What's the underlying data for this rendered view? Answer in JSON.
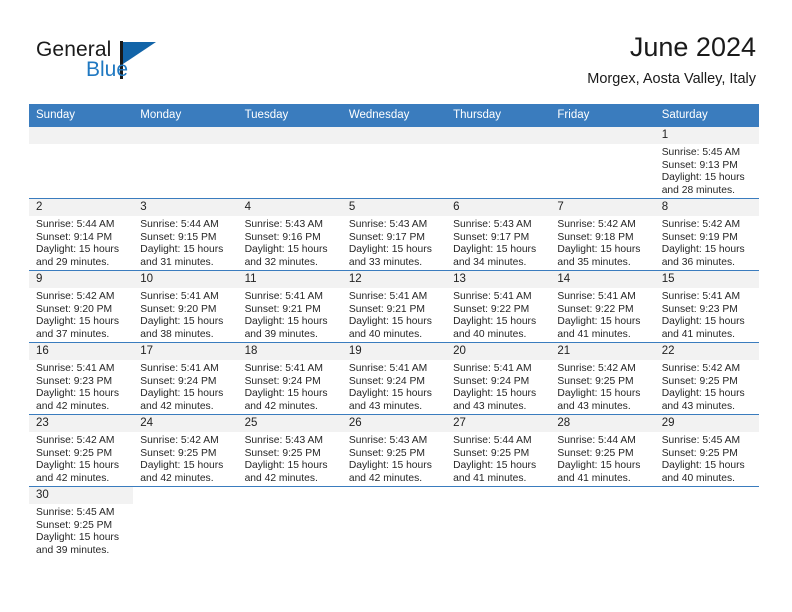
{
  "brand": {
    "word_one": "General",
    "word_two": "Blue",
    "flag_icon": "triangle-flag-icon"
  },
  "header": {
    "month_title": "June 2024",
    "location": "Morgex, Aosta Valley, Italy"
  },
  "colors": {
    "header_blue": "#3a7cbe",
    "brand_blue": "#1f78c1",
    "flag_blue": "#1264a8",
    "daynum_band": "#f2f2f2"
  },
  "weekdays": [
    "Sunday",
    "Monday",
    "Tuesday",
    "Wednesday",
    "Thursday",
    "Friday",
    "Saturday"
  ],
  "weeks": [
    [
      {
        "day": "",
        "empty": true
      },
      {
        "day": "",
        "empty": true
      },
      {
        "day": "",
        "empty": true
      },
      {
        "day": "",
        "empty": true
      },
      {
        "day": "",
        "empty": true
      },
      {
        "day": "",
        "empty": true
      },
      {
        "day": "1",
        "sunrise": "Sunrise: 5:45 AM",
        "sunset": "Sunset: 9:13 PM",
        "daylight_1": "Daylight: 15 hours",
        "daylight_2": "and 28 minutes."
      }
    ],
    [
      {
        "day": "2",
        "sunrise": "Sunrise: 5:44 AM",
        "sunset": "Sunset: 9:14 PM",
        "daylight_1": "Daylight: 15 hours",
        "daylight_2": "and 29 minutes."
      },
      {
        "day": "3",
        "sunrise": "Sunrise: 5:44 AM",
        "sunset": "Sunset: 9:15 PM",
        "daylight_1": "Daylight: 15 hours",
        "daylight_2": "and 31 minutes."
      },
      {
        "day": "4",
        "sunrise": "Sunrise: 5:43 AM",
        "sunset": "Sunset: 9:16 PM",
        "daylight_1": "Daylight: 15 hours",
        "daylight_2": "and 32 minutes."
      },
      {
        "day": "5",
        "sunrise": "Sunrise: 5:43 AM",
        "sunset": "Sunset: 9:17 PM",
        "daylight_1": "Daylight: 15 hours",
        "daylight_2": "and 33 minutes."
      },
      {
        "day": "6",
        "sunrise": "Sunrise: 5:43 AM",
        "sunset": "Sunset: 9:17 PM",
        "daylight_1": "Daylight: 15 hours",
        "daylight_2": "and 34 minutes."
      },
      {
        "day": "7",
        "sunrise": "Sunrise: 5:42 AM",
        "sunset": "Sunset: 9:18 PM",
        "daylight_1": "Daylight: 15 hours",
        "daylight_2": "and 35 minutes."
      },
      {
        "day": "8",
        "sunrise": "Sunrise: 5:42 AM",
        "sunset": "Sunset: 9:19 PM",
        "daylight_1": "Daylight: 15 hours",
        "daylight_2": "and 36 minutes."
      }
    ],
    [
      {
        "day": "9",
        "sunrise": "Sunrise: 5:42 AM",
        "sunset": "Sunset: 9:20 PM",
        "daylight_1": "Daylight: 15 hours",
        "daylight_2": "and 37 minutes."
      },
      {
        "day": "10",
        "sunrise": "Sunrise: 5:41 AM",
        "sunset": "Sunset: 9:20 PM",
        "daylight_1": "Daylight: 15 hours",
        "daylight_2": "and 38 minutes."
      },
      {
        "day": "11",
        "sunrise": "Sunrise: 5:41 AM",
        "sunset": "Sunset: 9:21 PM",
        "daylight_1": "Daylight: 15 hours",
        "daylight_2": "and 39 minutes."
      },
      {
        "day": "12",
        "sunrise": "Sunrise: 5:41 AM",
        "sunset": "Sunset: 9:21 PM",
        "daylight_1": "Daylight: 15 hours",
        "daylight_2": "and 40 minutes."
      },
      {
        "day": "13",
        "sunrise": "Sunrise: 5:41 AM",
        "sunset": "Sunset: 9:22 PM",
        "daylight_1": "Daylight: 15 hours",
        "daylight_2": "and 40 minutes."
      },
      {
        "day": "14",
        "sunrise": "Sunrise: 5:41 AM",
        "sunset": "Sunset: 9:22 PM",
        "daylight_1": "Daylight: 15 hours",
        "daylight_2": "and 41 minutes."
      },
      {
        "day": "15",
        "sunrise": "Sunrise: 5:41 AM",
        "sunset": "Sunset: 9:23 PM",
        "daylight_1": "Daylight: 15 hours",
        "daylight_2": "and 41 minutes."
      }
    ],
    [
      {
        "day": "16",
        "sunrise": "Sunrise: 5:41 AM",
        "sunset": "Sunset: 9:23 PM",
        "daylight_1": "Daylight: 15 hours",
        "daylight_2": "and 42 minutes."
      },
      {
        "day": "17",
        "sunrise": "Sunrise: 5:41 AM",
        "sunset": "Sunset: 9:24 PM",
        "daylight_1": "Daylight: 15 hours",
        "daylight_2": "and 42 minutes."
      },
      {
        "day": "18",
        "sunrise": "Sunrise: 5:41 AM",
        "sunset": "Sunset: 9:24 PM",
        "daylight_1": "Daylight: 15 hours",
        "daylight_2": "and 42 minutes."
      },
      {
        "day": "19",
        "sunrise": "Sunrise: 5:41 AM",
        "sunset": "Sunset: 9:24 PM",
        "daylight_1": "Daylight: 15 hours",
        "daylight_2": "and 43 minutes."
      },
      {
        "day": "20",
        "sunrise": "Sunrise: 5:41 AM",
        "sunset": "Sunset: 9:24 PM",
        "daylight_1": "Daylight: 15 hours",
        "daylight_2": "and 43 minutes."
      },
      {
        "day": "21",
        "sunrise": "Sunrise: 5:42 AM",
        "sunset": "Sunset: 9:25 PM",
        "daylight_1": "Daylight: 15 hours",
        "daylight_2": "and 43 minutes."
      },
      {
        "day": "22",
        "sunrise": "Sunrise: 5:42 AM",
        "sunset": "Sunset: 9:25 PM",
        "daylight_1": "Daylight: 15 hours",
        "daylight_2": "and 43 minutes."
      }
    ],
    [
      {
        "day": "23",
        "sunrise": "Sunrise: 5:42 AM",
        "sunset": "Sunset: 9:25 PM",
        "daylight_1": "Daylight: 15 hours",
        "daylight_2": "and 42 minutes."
      },
      {
        "day": "24",
        "sunrise": "Sunrise: 5:42 AM",
        "sunset": "Sunset: 9:25 PM",
        "daylight_1": "Daylight: 15 hours",
        "daylight_2": "and 42 minutes."
      },
      {
        "day": "25",
        "sunrise": "Sunrise: 5:43 AM",
        "sunset": "Sunset: 9:25 PM",
        "daylight_1": "Daylight: 15 hours",
        "daylight_2": "and 42 minutes."
      },
      {
        "day": "26",
        "sunrise": "Sunrise: 5:43 AM",
        "sunset": "Sunset: 9:25 PM",
        "daylight_1": "Daylight: 15 hours",
        "daylight_2": "and 42 minutes."
      },
      {
        "day": "27",
        "sunrise": "Sunrise: 5:44 AM",
        "sunset": "Sunset: 9:25 PM",
        "daylight_1": "Daylight: 15 hours",
        "daylight_2": "and 41 minutes."
      },
      {
        "day": "28",
        "sunrise": "Sunrise: 5:44 AM",
        "sunset": "Sunset: 9:25 PM",
        "daylight_1": "Daylight: 15 hours",
        "daylight_2": "and 41 minutes."
      },
      {
        "day": "29",
        "sunrise": "Sunrise: 5:45 AM",
        "sunset": "Sunset: 9:25 PM",
        "daylight_1": "Daylight: 15 hours",
        "daylight_2": "and 40 minutes."
      }
    ],
    [
      {
        "day": "30",
        "sunrise": "Sunrise: 5:45 AM",
        "sunset": "Sunset: 9:25 PM",
        "daylight_1": "Daylight: 15 hours",
        "daylight_2": "and 39 minutes."
      },
      {
        "day": "",
        "blank": true
      },
      {
        "day": "",
        "blank": true
      },
      {
        "day": "",
        "blank": true
      },
      {
        "day": "",
        "blank": true
      },
      {
        "day": "",
        "blank": true
      },
      {
        "day": "",
        "blank": true
      }
    ]
  ]
}
